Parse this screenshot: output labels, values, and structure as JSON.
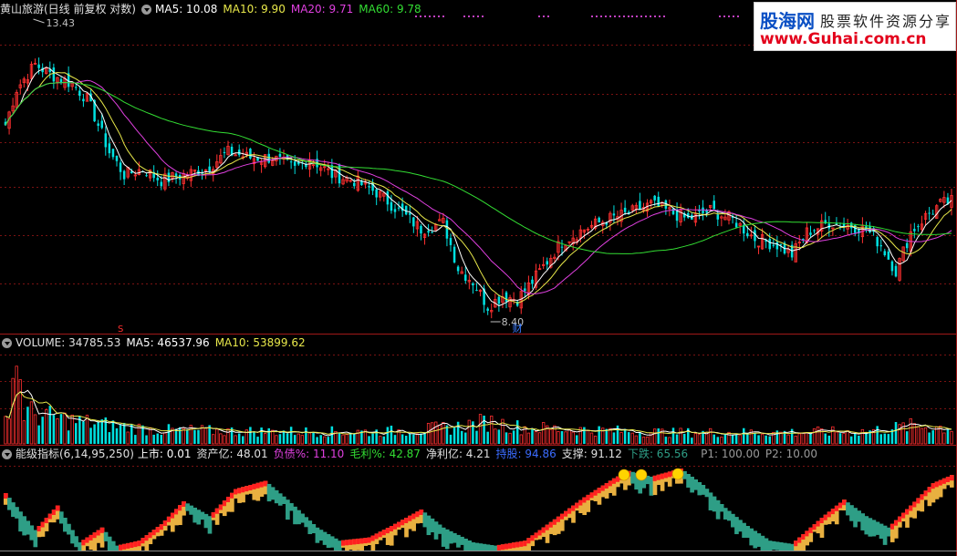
{
  "colors": {
    "up": "#ff3030",
    "down": "#00e0e0",
    "ma5": "#ffffff",
    "ma10": "#e8e84a",
    "ma20": "#e040e0",
    "ma60": "#33dd33",
    "pos": "#ff2020",
    "teal": "#2e9e86",
    "yellow": "#e8b040"
  },
  "header": {
    "title": "黄山旅游(日线 前复权 对数)",
    "ma5": "MA5: 10.08",
    "ma10": "MA10: 9.90",
    "ma20": "MA20: 9.71",
    "ma60": "MA60: 9.78"
  },
  "price_annotations": {
    "high": "13.43",
    "low": "8.40",
    "cai": "财",
    "s": "S"
  },
  "volume_header": {
    "volume": "VOLUME: 34785.53",
    "ma5": "MA5: 46537.96",
    "ma10": "MA10: 53899.62"
  },
  "indicator_header": {
    "name": "能级指标(6,14,95,250)",
    "listing": "上市: 0.01",
    "assets": "资产亿: 48.01",
    "debt": "负债%: 11.10",
    "margin": "毛利%: 42.87",
    "net": "净利亿: 4.21",
    "hold": "持股: 94.86",
    "support": "支撑: 91.12",
    "fall": "下跌: 65.56",
    "p1": "P1: 100.00",
    "p2": "P2: 10.00"
  },
  "logo": {
    "main": "股海网",
    "sub": "股票软件资源分享",
    "url": "www.Guhai.com.cn"
  },
  "chart_data": [
    {
      "type": "candlestick",
      "title": "黄山旅游(日线 前复权 对数)",
      "series_names": [
        "MA5",
        "MA10",
        "MA20",
        "MA60"
      ],
      "high_mark": 13.43,
      "low_mark": 8.4,
      "close_anchors": [
        [
          0,
          11.4
        ],
        [
          3,
          12.1
        ],
        [
          8,
          12.6
        ],
        [
          12,
          12.4
        ],
        [
          18,
          12.2
        ],
        [
          22,
          11.9
        ],
        [
          28,
          10.9
        ],
        [
          32,
          10.5
        ],
        [
          37,
          10.6
        ],
        [
          42,
          10.4
        ],
        [
          48,
          10.5
        ],
        [
          54,
          10.6
        ],
        [
          60,
          10.9
        ],
        [
          66,
          10.8
        ],
        [
          72,
          10.8
        ],
        [
          78,
          10.6
        ],
        [
          82,
          10.8
        ],
        [
          88,
          10.5
        ],
        [
          94,
          10.4
        ],
        [
          100,
          10.2
        ],
        [
          106,
          9.9
        ],
        [
          112,
          9.6
        ],
        [
          118,
          9.7
        ],
        [
          122,
          9.0
        ],
        [
          126,
          8.8
        ],
        [
          130,
          8.45
        ],
        [
          134,
          8.6
        ],
        [
          138,
          8.55
        ],
        [
          142,
          8.8
        ],
        [
          146,
          9.1
        ],
        [
          150,
          9.4
        ],
        [
          156,
          9.6
        ],
        [
          162,
          9.75
        ],
        [
          168,
          9.85
        ],
        [
          174,
          10.0
        ],
        [
          178,
          9.9
        ],
        [
          184,
          9.75
        ],
        [
          190,
          9.9
        ],
        [
          196,
          9.75
        ],
        [
          202,
          9.45
        ],
        [
          208,
          9.35
        ],
        [
          212,
          9.2
        ],
        [
          216,
          9.55
        ],
        [
          222,
          9.7
        ],
        [
          228,
          9.65
        ],
        [
          232,
          9.6
        ],
        [
          236,
          9.35
        ],
        [
          240,
          8.95
        ],
        [
          244,
          9.55
        ],
        [
          248,
          9.8
        ],
        [
          252,
          10.0
        ],
        [
          255,
          10.05
        ]
      ]
    },
    {
      "type": "bar",
      "title": "VOLUME",
      "series_names": [
        "MA5",
        "MA10"
      ],
      "last_value": 34785.53,
      "ma5": 46537.96,
      "ma10": 53899.62,
      "vol_anchors": [
        [
          0,
          60
        ],
        [
          3,
          220
        ],
        [
          5,
          80
        ],
        [
          10,
          70
        ],
        [
          20,
          55
        ],
        [
          40,
          35
        ],
        [
          60,
          32
        ],
        [
          100,
          30
        ],
        [
          120,
          40
        ],
        [
          130,
          55
        ],
        [
          140,
          40
        ],
        [
          180,
          28
        ],
        [
          230,
          30
        ],
        [
          245,
          45
        ],
        [
          255,
          40
        ]
      ]
    },
    {
      "type": "area",
      "title": "能级指标(6,14,95,250)",
      "series_names": [
        "上市",
        "资产亿",
        "负债%",
        "毛利%",
        "净利亿",
        "持股",
        "支撑",
        "下跌",
        "P1",
        "P2"
      ],
      "ylim": [
        0,
        100
      ],
      "wave_anchors": [
        [
          0,
          70
        ],
        [
          8,
          25
        ],
        [
          14,
          55
        ],
        [
          20,
          10
        ],
        [
          26,
          28
        ],
        [
          30,
          6
        ],
        [
          36,
          12
        ],
        [
          42,
          32
        ],
        [
          48,
          60
        ],
        [
          55,
          42
        ],
        [
          62,
          75
        ],
        [
          70,
          85
        ],
        [
          76,
          62
        ],
        [
          84,
          28
        ],
        [
          90,
          12
        ],
        [
          98,
          16
        ],
        [
          104,
          30
        ],
        [
          112,
          50
        ],
        [
          118,
          28
        ],
        [
          126,
          10
        ],
        [
          132,
          6
        ],
        [
          140,
          12
        ],
        [
          148,
          38
        ],
        [
          156,
          65
        ],
        [
          164,
          88
        ],
        [
          168,
          97
        ],
        [
          174,
          90
        ],
        [
          182,
          100
        ],
        [
          188,
          80
        ],
        [
          194,
          52
        ],
        [
          200,
          30
        ],
        [
          206,
          12
        ],
        [
          212,
          8
        ],
        [
          220,
          40
        ],
        [
          226,
          62
        ],
        [
          232,
          42
        ],
        [
          238,
          28
        ],
        [
          244,
          55
        ],
        [
          250,
          82
        ],
        [
          255,
          92
        ]
      ]
    }
  ]
}
